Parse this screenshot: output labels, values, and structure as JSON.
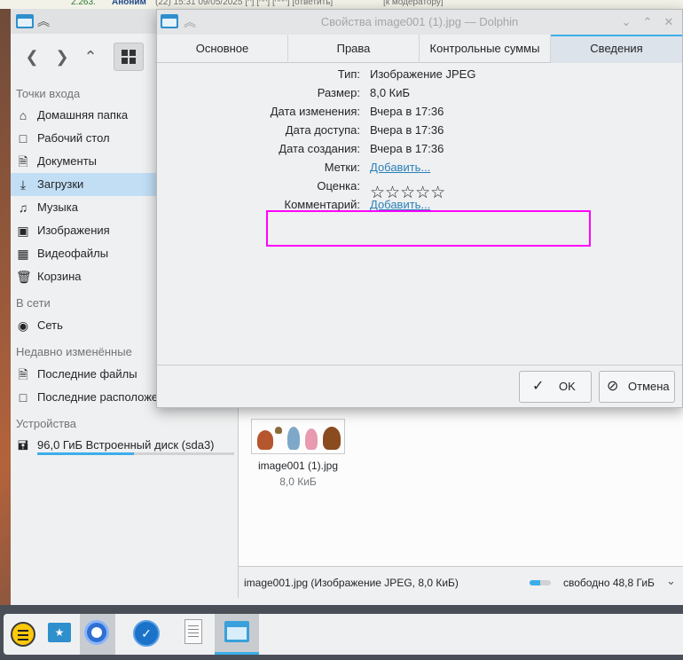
{
  "browser_strip": {
    "num": "2.263.",
    "anon": "Аноним",
    "rest": "(22) 15:31 09/05/2025 [^] [^^] [^^^] [ответить]",
    "mod": "[к модератору]"
  },
  "dolphin": {
    "places": {
      "section_entry": "Точки входа",
      "items": [
        {
          "label": "Домашняя папка",
          "icon": "home-icon"
        },
        {
          "label": "Рабочий стол",
          "icon": "desktop-icon"
        },
        {
          "label": "Документы",
          "icon": "documents-icon"
        },
        {
          "label": "Загрузки",
          "icon": "download-icon",
          "selected": true
        },
        {
          "label": "Музыка",
          "icon": "music-icon"
        },
        {
          "label": "Изображения",
          "icon": "image-icon"
        },
        {
          "label": "Видеофайлы",
          "icon": "video-icon"
        },
        {
          "label": "Корзина",
          "icon": "trash-icon"
        }
      ],
      "section_network": "В сети",
      "network_item": "Сеть",
      "section_recent": "Недавно изменённые",
      "recent_files": "Последние файлы",
      "recent_locations": "Последние расположе",
      "section_devices": "Устройства",
      "disk_label": "96,0 ГиБ Встроенный диск (sda3)",
      "disk_used_fraction": 0.49
    },
    "file": {
      "name": "image001 (1).jpg",
      "size": "8,0 КиБ"
    },
    "statusbar": {
      "text": "image001.jpg (Изображение JPEG, 8,0 КиБ)",
      "free": "свободно 48,8 ГиБ",
      "free_used_fraction": 0.5
    }
  },
  "dialog": {
    "title": "Свойства image001 (1).jpg — Dolphin",
    "tabs": [
      {
        "label": "Основное"
      },
      {
        "label": "Права"
      },
      {
        "label": "Контрольные суммы"
      },
      {
        "label": "Сведения",
        "active": true
      }
    ],
    "props": {
      "type_label": "Тип:",
      "type_value": "Изображение JPEG",
      "size_label": "Размер:",
      "size_value": "8,0 КиБ",
      "modified_label": "Дата изменения:",
      "modified_value": "Вчера в 17:36",
      "accessed_label": "Дата доступа:",
      "accessed_value": "Вчера в 17:36",
      "created_label": "Дата создания:",
      "created_value": "Вчера в 17:36",
      "tags_label": "Метки:",
      "tags_link": "Добавить...",
      "rating_label": "Оценка:",
      "rating_stars": "☆☆☆☆☆",
      "rating_value": 0,
      "comment_label": "Комментарий:",
      "comment_link": "Добавить..."
    },
    "ok_label": "OK",
    "cancel_label": "Отмена"
  },
  "colors": {
    "accent": "#3daee9",
    "selection": "#c2def5",
    "highlight_border": "#ff00ff",
    "link": "#2980b9"
  }
}
